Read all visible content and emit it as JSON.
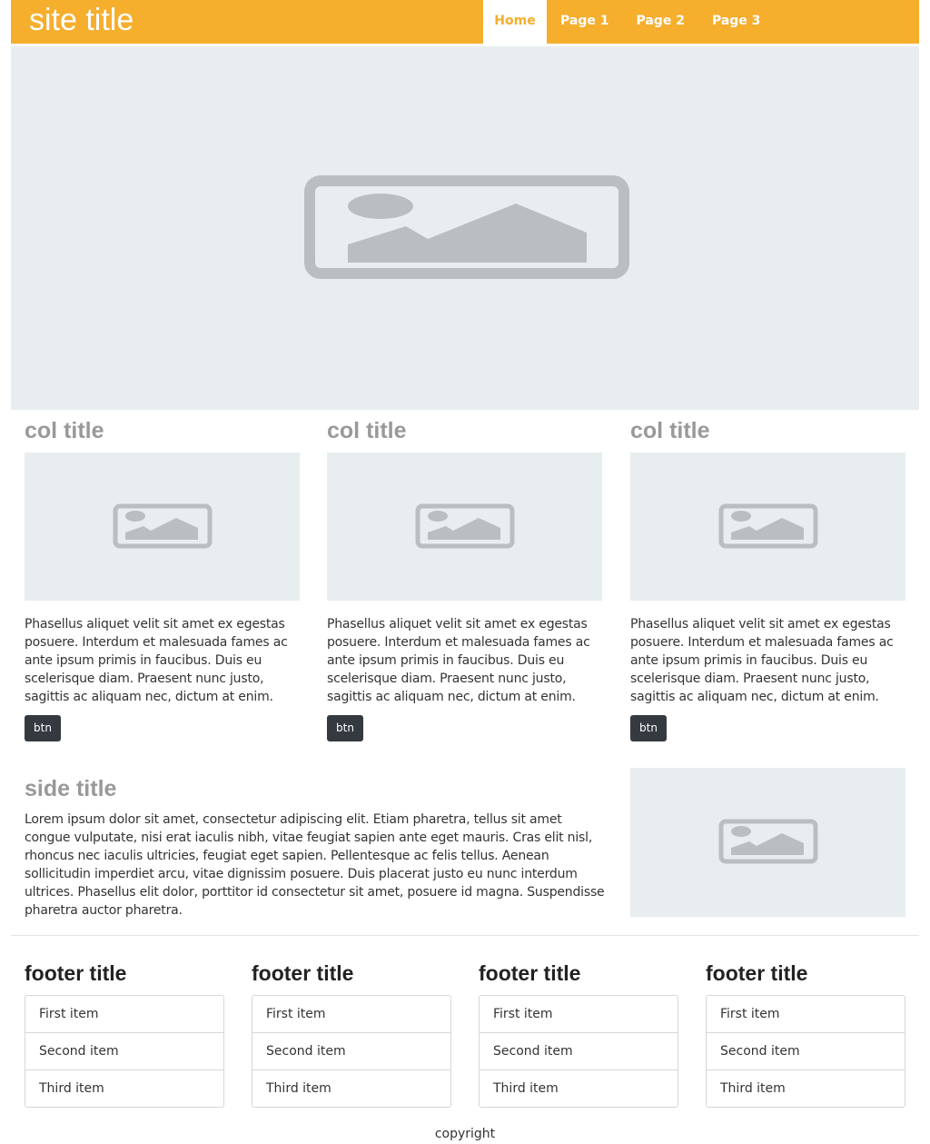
{
  "header": {
    "site_title": "site title",
    "nav": [
      {
        "label": "Home",
        "active": true
      },
      {
        "label": "Page 1",
        "active": false
      },
      {
        "label": "Page 2",
        "active": false
      },
      {
        "label": "Page 3",
        "active": false
      }
    ]
  },
  "hero": {
    "icon": "image-placeholder-icon"
  },
  "columns": [
    {
      "title": "col title",
      "icon": "image-placeholder-icon",
      "text": "Phasellus aliquet velit sit amet ex egestas posuere. Interdum et malesuada fames ac ante ipsum primis in faucibus. Duis eu scelerisque diam. Praesent nunc justo, sagittis ac aliquam nec, dictum at enim.",
      "button": "btn"
    },
    {
      "title": "col title",
      "icon": "image-placeholder-icon",
      "text": "Phasellus aliquet velit sit amet ex egestas posuere. Interdum et malesuada fames ac ante ipsum primis in faucibus. Duis eu scelerisque diam. Praesent nunc justo, sagittis ac aliquam nec, dictum at enim.",
      "button": "btn"
    },
    {
      "title": "col title",
      "icon": "image-placeholder-icon",
      "text": "Phasellus aliquet velit sit amet ex egestas posuere. Interdum et malesuada fames ac ante ipsum primis in faucibus. Duis eu scelerisque diam. Praesent nunc justo, sagittis ac aliquam nec, dictum at enim.",
      "button": "btn"
    }
  ],
  "side": {
    "title": "side title",
    "text": "Lorem ipsum dolor sit amet, consectetur adipiscing elit. Etiam pharetra, tellus sit amet congue vulputate, nisi erat iaculis nibh, vitae feugiat sapien ante eget mauris. Cras elit nisl, rhoncus nec iaculis ultricies, feugiat eget sapien. Pellentesque ac felis tellus. Aenean sollicitudin imperdiet arcu, vitae dignissim posuere. Duis placerat justo eu nunc interdum ultrices. Phasellus elit dolor, porttitor id consectetur sit amet, posuere id magna. Suspendisse pharetra auctor pharetra.",
    "icon": "image-placeholder-icon"
  },
  "footer": {
    "columns": [
      {
        "title": "footer title",
        "items": [
          "First item",
          "Second item",
          "Third item"
        ]
      },
      {
        "title": "footer title",
        "items": [
          "First item",
          "Second item",
          "Third item"
        ]
      },
      {
        "title": "footer title",
        "items": [
          "First item",
          "Second item",
          "Third item"
        ]
      },
      {
        "title": "footer title",
        "items": [
          "First item",
          "Second item",
          "Third item"
        ]
      }
    ],
    "copyright": "copyright"
  },
  "colors": {
    "brand": "#f6ae2d",
    "placeholder_bg": "#e8edf0",
    "placeholder_icon": "#babec1",
    "button_bg": "#343a40"
  }
}
